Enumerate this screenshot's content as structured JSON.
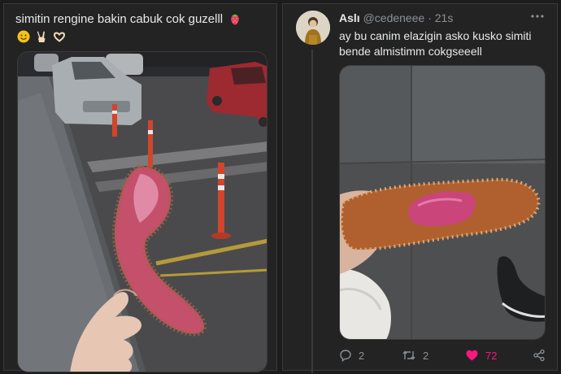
{
  "left_tweet": {
    "text": "simitin rengine bakin cabuk cok guzelll",
    "emoji_row": [
      "smiling-face-emoji",
      "victory-hand-emoji",
      "heart-hands-emoji"
    ],
    "trailing_emoji": "strawberry-emoji"
  },
  "right_tweet": {
    "display_name": "Aslı",
    "handle": "@cedeneee",
    "separator": "·",
    "time": "21s",
    "text": "ay bu canim elazigin asko kusko simiti bende almistimm cokgseeell",
    "actions": {
      "replies": "2",
      "retweets": "2",
      "likes": "72"
    }
  },
  "colors": {
    "background": "#1c1c1c",
    "panel": "#232323",
    "text": "#e7e9ea",
    "muted": "#8b9197",
    "like": "#f91880"
  }
}
